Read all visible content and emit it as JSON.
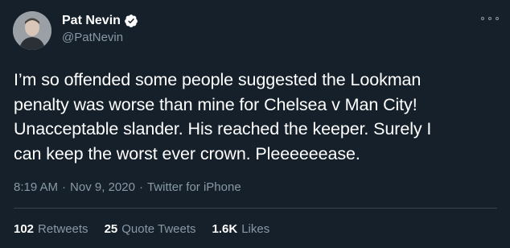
{
  "user": {
    "display_name": "Pat Nevin",
    "handle": "@PatNevin",
    "verified": true
  },
  "tweet": {
    "text": "I’m so offended some people suggested the Lookman\npenalty was worse than mine for Chelsea v Man City!\nUnacceptable slander. His reached the keeper. Surely I\ncan keep the worst ever crown. Pleeeeeease.",
    "time": "8:19 AM",
    "date": "Nov 9, 2020",
    "source": "Twitter for iPhone",
    "separator": "·"
  },
  "stats": {
    "retweets": {
      "count": "102",
      "label": "Retweets"
    },
    "quote_tweets": {
      "count": "25",
      "label": "Quote Tweets"
    },
    "likes": {
      "count": "1.6K",
      "label": "Likes"
    }
  },
  "icons": {
    "verified": "verified-badge-icon",
    "more": "more-options-icon"
  },
  "colors": {
    "background": "#15202b",
    "text": "#ffffff",
    "secondary": "#8899a6",
    "divider": "#38444d"
  }
}
